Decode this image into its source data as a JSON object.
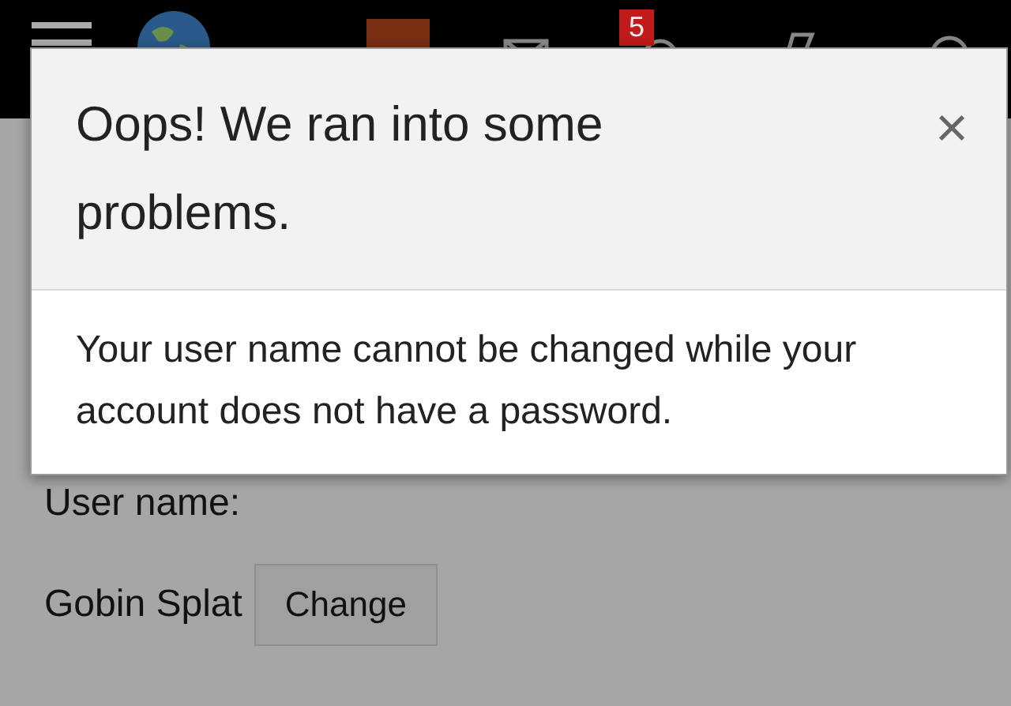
{
  "top_bar": {
    "notification_count": "5"
  },
  "page": {
    "field_label": "User name:",
    "user_name": "Gobin Splat",
    "change_button": "Change"
  },
  "dialog": {
    "title": "Oops! We ran into some problems.",
    "close": "×",
    "message": "Your user name cannot be changed while your account does not have a password."
  }
}
